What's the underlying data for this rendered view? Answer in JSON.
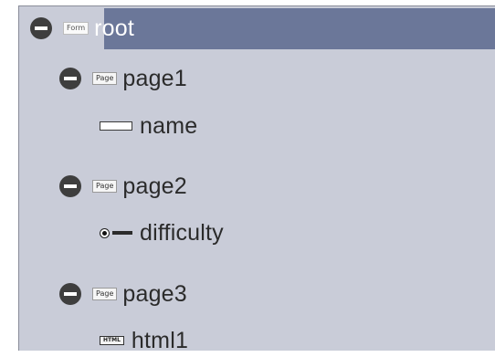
{
  "tree": {
    "root": {
      "badge": "Form",
      "label": "root"
    },
    "page1": {
      "badge": "Page",
      "label": "page1",
      "child": {
        "label": "name",
        "icon": "text-input-icon"
      }
    },
    "page2": {
      "badge": "Page",
      "label": "page2",
      "child": {
        "label": "difficulty",
        "icon": "radio-button-icon"
      }
    },
    "page3": {
      "badge": "Page",
      "label": "page3",
      "child": {
        "label": "html1",
        "icon": "html-icon",
        "badge": "HTML"
      }
    }
  },
  "colors": {
    "panel": "#c9ccd8",
    "selection": "#6b7799",
    "toggle": "#3e3e3e"
  }
}
